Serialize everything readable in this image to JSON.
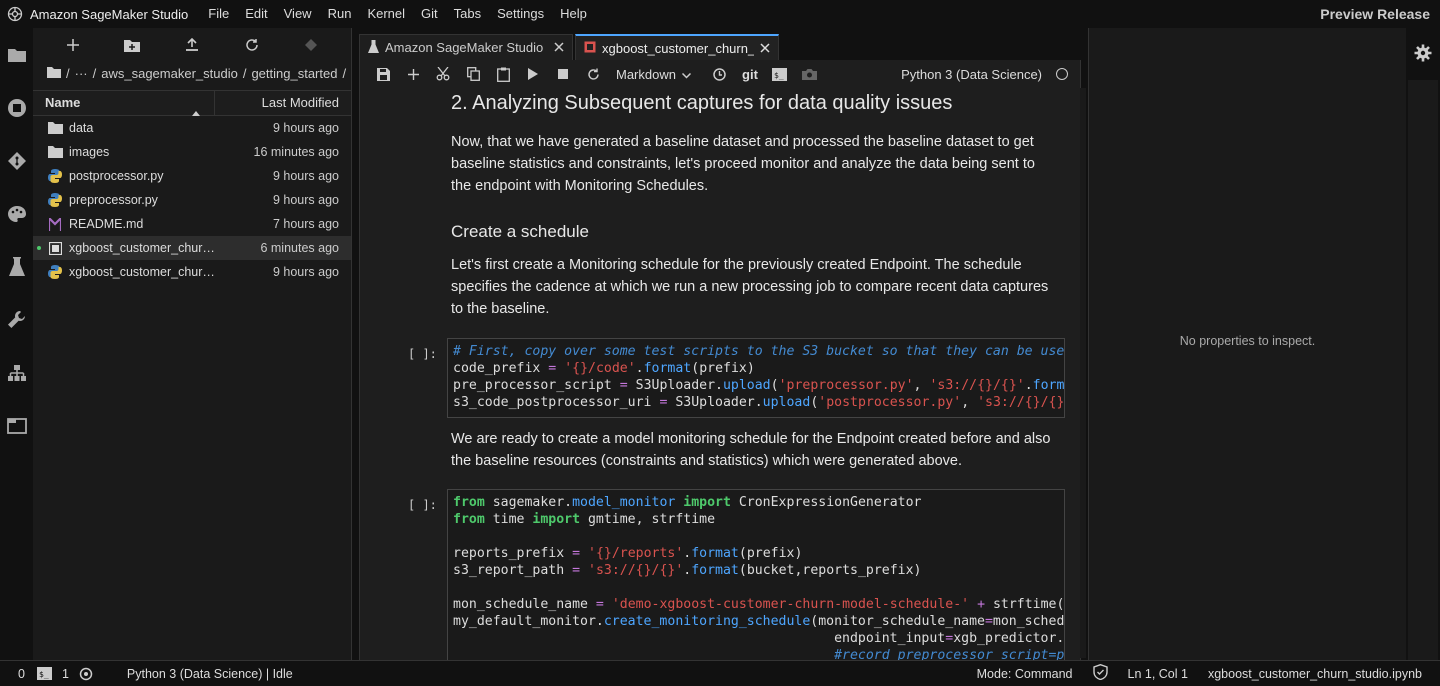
{
  "menubar": {
    "app_title": "Amazon SageMaker Studio",
    "items": [
      "File",
      "Edit",
      "View",
      "Run",
      "Kernel",
      "Git",
      "Tabs",
      "Settings",
      "Help"
    ],
    "preview_label": "Preview Release"
  },
  "breadcrumb": {
    "root": "/",
    "ellipsis": "···",
    "sep": "/",
    "parts": [
      "aws_sagemaker_studio",
      "getting_started"
    ]
  },
  "filebrowser": {
    "header_name": "Name",
    "header_modified": "Last Modified",
    "files": [
      {
        "name": "data",
        "icon": "folder-icon",
        "modified": "9 hours ago"
      },
      {
        "name": "images",
        "icon": "folder-icon",
        "modified": "16 minutes ago"
      },
      {
        "name": "postprocessor.py",
        "icon": "python-file-icon",
        "modified": "9 hours ago"
      },
      {
        "name": "preprocessor.py",
        "icon": "python-file-icon",
        "modified": "9 hours ago"
      },
      {
        "name": "README.md",
        "icon": "markdown-file-icon",
        "modified": "7 hours ago"
      },
      {
        "name": "xgboost_customer_churn_studio.ipynb",
        "icon": "notebook-file-icon",
        "modified": "6 minutes ago",
        "selected": true
      },
      {
        "name": "xgboost_customer_churn_studio.py",
        "icon": "python-file-icon",
        "modified": "9 hours ago"
      }
    ]
  },
  "tabs": [
    {
      "label": "Amazon SageMaker Studio",
      "icon": "flask-icon"
    },
    {
      "label": "xgboost_customer_churn_stu",
      "icon": "notebook-icon",
      "active": true
    }
  ],
  "nbtoolbar": {
    "cell_type": "Markdown",
    "git_label": "git",
    "kernel": "Python 3 (Data Science)"
  },
  "notebook": {
    "h2": "2. Analyzing Subsequent captures for data quality issues",
    "p1": "Now, that we have generated a baseline dataset and processed the baseline dataset to get baseline statistics and constraints, let's proceed monitor and analyze the data being sent to the endpoint with Monitoring Schedules.",
    "h3": "Create a schedule",
    "p2": "Let's first create a Monitoring schedule for the previously created Endpoint. The schedule specifies the cadence at which we run a new processing job to compare recent data captures to the baseline.",
    "prompt": "[ ]:",
    "p3": "We are ready to create a model monitoring schedule for the Endpoint created before and also the baseline resources (constraints and statistics) which were generated above."
  },
  "inspector": {
    "empty_text": "No properties to inspect."
  },
  "statusbar": {
    "count1": "0",
    "count2": "1",
    "kernel_status": "Python 3 (Data Science) | Idle",
    "mode": "Mode: Command",
    "position": "Ln 1, Col 1",
    "filename": "xgboost_customer_churn_studio.ipynb"
  }
}
